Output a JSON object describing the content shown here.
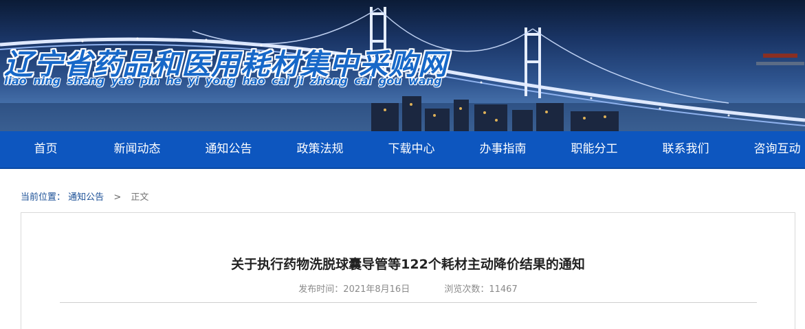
{
  "site": {
    "title": "辽宁省药品和医用耗材集中采购网",
    "pinyin": "liao ning sheng yao pin he yi yong hao cai ji zhong cai gou wang"
  },
  "nav": {
    "items": [
      {
        "label": "首页"
      },
      {
        "label": "新闻动态"
      },
      {
        "label": "通知公告"
      },
      {
        "label": "政策法规"
      },
      {
        "label": "下载中心"
      },
      {
        "label": "办事指南"
      },
      {
        "label": "职能分工"
      },
      {
        "label": "联系我们"
      },
      {
        "label": "咨询互动"
      }
    ]
  },
  "breadcrumb": {
    "label": "当前位置：",
    "link": "通知公告",
    "separator": ">",
    "current": "正文"
  },
  "article": {
    "title": "关于执行药物洗脱球囊导管等122个耗材主动降价结果的通知",
    "publish_label": "发布时间：",
    "publish_date": "2021年8月16日",
    "views_label": "浏览次数：",
    "views": "11467"
  },
  "colors": {
    "nav_bg": "#0d56bf",
    "title_blue": "#1768c8",
    "link_blue": "#1a4f96"
  }
}
